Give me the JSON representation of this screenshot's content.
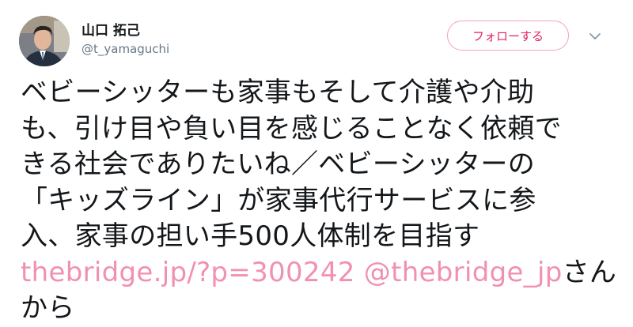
{
  "header": {
    "display_name": "山口 拓己",
    "handle": "@t_yamaguchi",
    "follow_label": "フォローする",
    "more_icon": "chevron-down-icon"
  },
  "tweet": {
    "lines": [
      "ベビーシッターも家事もそして介護や介助",
      "も、引け目や負い目を感じることなく依頼で",
      "きる社会でありたいね／ベビーシッターの",
      "「キッズライン」が家事代行サービスに参",
      "入、家事の担い手500人体制を目指す"
    ],
    "link_url_text": "thebridge.jp/?p=300242",
    "mention_text": "@thebridge_jp",
    "suffix_same_line": "さん",
    "last_line": "から"
  },
  "colors": {
    "accent": "#e0245e",
    "link": "#f190b2",
    "secondary_text": "#657786"
  }
}
